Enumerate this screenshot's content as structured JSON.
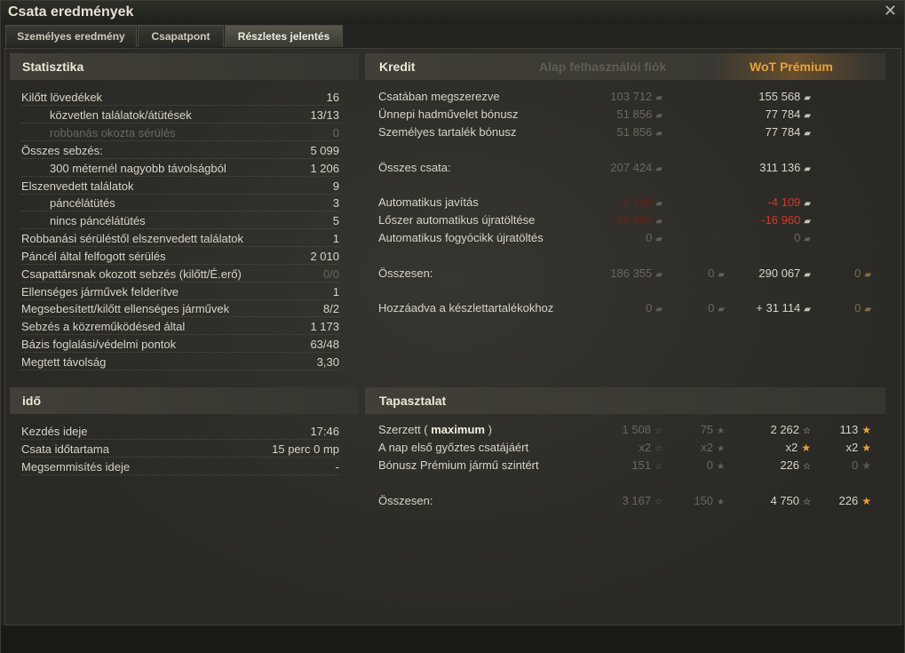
{
  "window": {
    "title": "Csata eredmények",
    "close": "✕"
  },
  "tabs": [
    {
      "label": "Személyes eredmény"
    },
    {
      "label": "Csapatpont"
    },
    {
      "label": "Részletes jelentés"
    }
  ],
  "stats": {
    "header": "Statisztika",
    "rows": [
      {
        "label": "Kilőtt lövedékek",
        "value": "16"
      },
      {
        "label": "közvetlen találatok/átütések",
        "value": "13/13"
      },
      {
        "label": "robbanás okozta sérülés",
        "value": "0"
      },
      {
        "label": "Összes sebzés:",
        "value": "5 099"
      },
      {
        "label": "300 méternél nagyobb távolságból",
        "value": "1 206"
      },
      {
        "label": "Elszenvedett találatok",
        "value": "9"
      },
      {
        "label": "páncélátütés",
        "value": "3"
      },
      {
        "label": "nincs páncélátütés",
        "value": "5"
      },
      {
        "label": "Robbanási sérüléstől elszenvedett találatok",
        "value": "1"
      },
      {
        "label": "Páncél által felfogott sérülés",
        "value": "2 010"
      },
      {
        "label": "Csapattársnak okozott sebzés (kilőtt/É.erő)",
        "value": "0/0"
      },
      {
        "label": "Ellenséges járművek felderítve",
        "value": "1"
      },
      {
        "label": "Megsebesített/kilőtt ellenséges járművek",
        "value": "8/2"
      },
      {
        "label": "Sebzés a közreműködésed által",
        "value": "1 173"
      },
      {
        "label": "Bázis foglalási/védelmi pontok",
        "value": "63/48"
      },
      {
        "label": "Megtett távolság",
        "value": "3,30"
      }
    ]
  },
  "time": {
    "header": "idő",
    "rows": [
      {
        "label": "Kezdés ideje",
        "value": "17:46"
      },
      {
        "label": "Csata időtartama",
        "value": "15 perc 0 mp"
      },
      {
        "label": "Megsemmisítés ideje",
        "value": "-"
      }
    ]
  },
  "credit": {
    "header": "Kredit",
    "basic_header": "Alap felhasználói fiók",
    "premium_header": "WoT Prémium",
    "rows": [
      {
        "label": "Csatában megszerezve",
        "basic": "103 712",
        "premium": "155 568"
      },
      {
        "label": "Ünnepi hadművelet bónusz",
        "basic": "51 856",
        "premium": "77 784"
      },
      {
        "label": "Személyes tartalék bónusz",
        "basic": "51 856",
        "premium": "77 784"
      },
      {
        "label": "Összes csata:",
        "basic": "207 424",
        "premium": "311 136"
      },
      {
        "label": "Automatikus javítás",
        "basic": "-4 109",
        "premium": "-4 109"
      },
      {
        "label": "Lőszer automatikus újratöltése",
        "basic": "-16 960",
        "premium": "-16 960"
      },
      {
        "label": "Automatikus fogyócikk újratöltés",
        "basic": "0",
        "premium": "0"
      },
      {
        "label": "Összesen:",
        "basic": "186 355",
        "basic_gold": "0",
        "premium": "290 067",
        "premium_gold": "0"
      },
      {
        "label": "Hozzáadva a készlettartalékokhoz",
        "basic": "0",
        "basic_gold": "0",
        "premium": "+ 31 114",
        "premium_gold": "0"
      }
    ]
  },
  "xp": {
    "header": "Tapasztalat",
    "rows": [
      {
        "label": "Szerzett",
        "label_bold": "maximum",
        "basic": "1 508",
        "basic_free": "75",
        "premium": "2 262",
        "premium_free": "113"
      },
      {
        "label": "A nap első győztes csatájáért",
        "basic": "x2",
        "basic_free": "x2",
        "premium": "x2",
        "premium_free": "x2"
      },
      {
        "label": "Bónusz Prémium jármű szintért",
        "basic": "151",
        "basic_free": "0",
        "premium": "226",
        "premium_free": "0"
      },
      {
        "label": "Összesen:",
        "basic": "3 167",
        "basic_free": "150",
        "premium": "4 750",
        "premium_free": "226"
      }
    ]
  },
  "icons": {
    "credit": "credit-icon",
    "gold": "gold-icon",
    "xp": "xp-star-icon",
    "free_xp": "free-xp-star-icon"
  },
  "colors": {
    "premium": "#e8a23c",
    "negative": "#d8362a"
  }
}
